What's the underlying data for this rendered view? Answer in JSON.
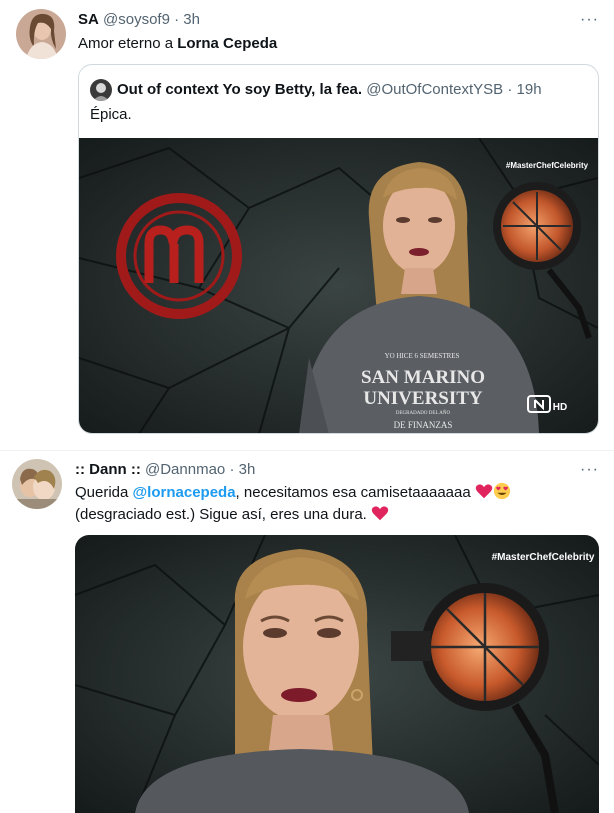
{
  "tweet1": {
    "name": "SA",
    "handle": "@soysof9",
    "separator": "·",
    "time": "3h",
    "more": "···",
    "text_prefix": "Amor eterno a ",
    "text_bold": "Lorna Cepeda",
    "quote": {
      "name": "Out of context Yo soy Betty, la fea.",
      "handle": "@OutOfContextYSB",
      "separator": "·",
      "time": "19h",
      "text": "Épica.",
      "image": {
        "watermark": "#MasterChefCelebrity",
        "shirt_small_top": "YO HICE 6 SEMESTRES",
        "shirt_line1": "SAN MARINO",
        "shirt_line2": "UNIVERSITY",
        "shirt_small_mid": "DEGRADADO DEL AÑO",
        "shirt_bottom": "DE FINANZAS",
        "channel_badge": "HD"
      }
    }
  },
  "tweet2": {
    "name": ":: Dann ::",
    "handle": "@Dannmao",
    "separator": "·",
    "time": "3h",
    "more": "···",
    "text_part1": "Querida ",
    "mention": "@lornacepeda",
    "text_part2": ", necesitamos esa camisetaaaaaaa",
    "text_line2": "(desgraciado est.) Sigue así, eres una dura.",
    "image": {
      "watermark": "#MasterChefCelebrity"
    }
  },
  "colors": {
    "accent": "#1d9bf0",
    "heart": "#e0245e",
    "secondary_text": "#536471",
    "border": "#cfd9de"
  },
  "icons": [
    "heart-emoji",
    "heart-eyes-emoji",
    "more-icon",
    "masterchef-logo-icon"
  ]
}
